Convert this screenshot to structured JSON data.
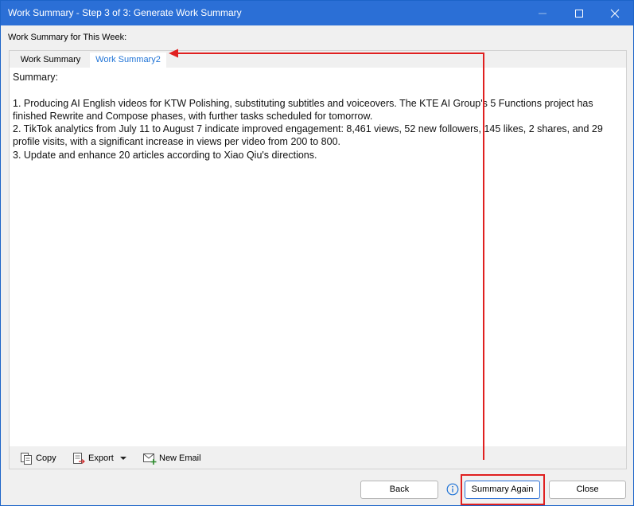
{
  "window": {
    "title": "Work Summary - Step 3 of 3: Generate Work Summary",
    "accent_color": "#2b6fd6"
  },
  "week_label": "Work Summary for This Week:",
  "tabs": [
    {
      "label": "Work Summary",
      "active": false
    },
    {
      "label": "Work Summary2",
      "active": true
    }
  ],
  "summary": {
    "heading": "Summary:",
    "body": "1. Producing AI English videos for KTW Polishing, substituting subtitles and voiceovers. The KTE AI Group's 5 Functions project has finished Rewrite and Compose phases, with further tasks scheduled for tomorrow.\n2. TikTok analytics from July 11 to August 7 indicate improved engagement: 8,461 views, 52 new followers, 145 likes, 2 shares, and 29 profile visits, with a significant increase in views per video from 200 to 800.\n3. Update and enhance 20 articles according to Xiao Qiu's directions."
  },
  "toolbar": {
    "copy_label": "Copy",
    "export_label": "Export",
    "new_email_label": "New Email"
  },
  "footer": {
    "back_label": "Back",
    "summary_again_label": "Summary Again",
    "close_label": "Close"
  },
  "annotation": {
    "color": "#e02020"
  }
}
